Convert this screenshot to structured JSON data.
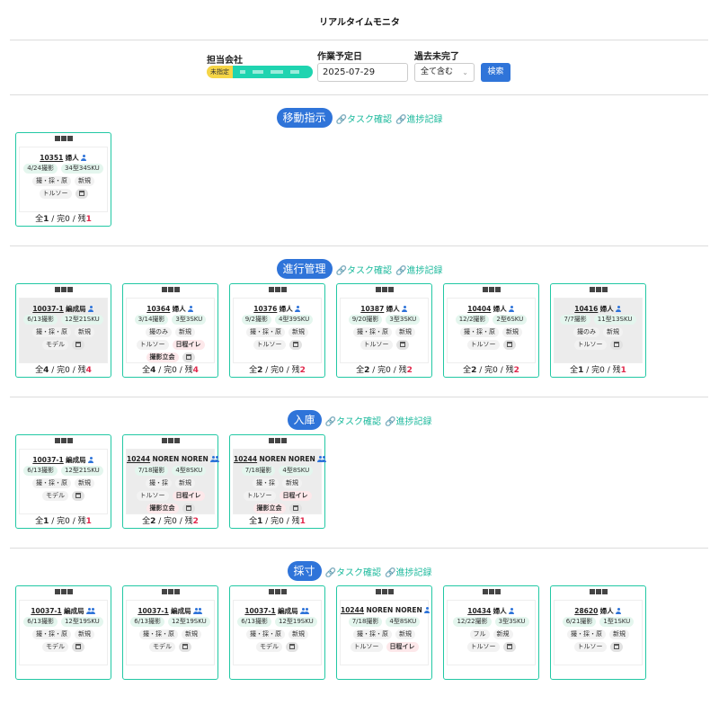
{
  "page": {
    "title": "リアルタイムモニタ"
  },
  "filter": {
    "company_label": "担当会社",
    "company_badge": "未指定",
    "date_label": "作業予定日",
    "date_value": "2025-07-29",
    "incomplete_label": "過去未完了",
    "incomplete_value": "全て含む",
    "search_label": "検索"
  },
  "sections": [
    {
      "title": "移動指示",
      "link1": "タスク確認",
      "link2": "進捗記録",
      "cards": [
        {
          "id": "10351",
          "name": "婦人",
          "icon": "person",
          "grey": false,
          "rows": [
            [
              "4/24撮影:green",
              "34型34SKU:green"
            ],
            [
              "撮・採・原",
              "新規"
            ],
            [
              "トルソー",
              "@cal"
            ]
          ],
          "total": "1",
          "done": "0",
          "rem": "1"
        }
      ]
    },
    {
      "title": "進行管理",
      "link1": "タスク確認",
      "link2": "進捗記録",
      "cards": [
        {
          "id": "10037-1",
          "name": "編成局",
          "icon": "person",
          "grey": true,
          "rows": [
            [
              "6/13撮影:green",
              "12型21SKU:green"
            ],
            [
              "撮・採・原",
              "新規"
            ],
            [
              "モデル",
              "@cal"
            ]
          ],
          "total": "4",
          "done": "0",
          "rem": "4"
        },
        {
          "id": "10364",
          "name": "婦人",
          "icon": "person",
          "grey": false,
          "rows": [
            [
              "3/14撮影:green",
              "3型3SKU:green"
            ],
            [
              "撮のみ",
              "新規"
            ],
            [
              "トルソー",
              "日程イレ:pink"
            ],
            [
              "撮影立会:pink",
              "@cal"
            ]
          ],
          "total": "4",
          "done": "0",
          "rem": "4"
        },
        {
          "id": "10376",
          "name": "婦人",
          "icon": "person",
          "grey": false,
          "rows": [
            [
              "9/2撮影:green",
              "4型39SKU:green"
            ],
            [
              "撮・採・原",
              "新規"
            ],
            [
              "トルソー",
              "@cal"
            ]
          ],
          "total": "2",
          "done": "0",
          "rem": "2"
        },
        {
          "id": "10387",
          "name": "婦人",
          "icon": "person",
          "grey": false,
          "rows": [
            [
              "9/20撮影:green",
              "3型3SKU:green"
            ],
            [
              "撮・採・原",
              "新規"
            ],
            [
              "トルソー",
              "@cal"
            ]
          ],
          "total": "2",
          "done": "0",
          "rem": "2"
        },
        {
          "id": "10404",
          "name": "婦人",
          "icon": "person",
          "grey": false,
          "rows": [
            [
              "12/2撮影:green",
              "2型6SKU:green"
            ],
            [
              "撮・採・原",
              "新規"
            ],
            [
              "トルソー",
              "@cal"
            ]
          ],
          "total": "2",
          "done": "0",
          "rem": "2"
        },
        {
          "id": "10416",
          "name": "婦人",
          "icon": "person",
          "grey": true,
          "rows": [
            [
              "7/7撮影:green",
              "11型13SKU:green"
            ],
            [
              "撮のみ",
              "新規"
            ],
            [
              "トルソー",
              "@cal"
            ]
          ],
          "total": "1",
          "done": "0",
          "rem": "1"
        }
      ]
    },
    {
      "title": "入庫",
      "link1": "タスク確認",
      "link2": "進捗記録",
      "cards": [
        {
          "id": "10037-1",
          "name": "編成局",
          "icon": "person",
          "grey": false,
          "rows": [
            [
              "6/13撮影:green",
              "12型21SKU:green"
            ],
            [
              "撮・採・原",
              "新規"
            ],
            [
              "モデル",
              "@cal"
            ]
          ],
          "total": "1",
          "done": "0",
          "rem": "1"
        },
        {
          "id": "10244",
          "name": "NOREN NOREN",
          "icon": "people",
          "grey": true,
          "rows": [
            [
              "7/18撮影:green",
              "4型8SKU:green"
            ],
            [
              "撮・採",
              "新規"
            ],
            [
              "トルソー",
              "日程イレ:pink"
            ],
            [
              "撮影立会:pink",
              "@cal"
            ]
          ],
          "total": "2",
          "done": "0",
          "rem": "2"
        },
        {
          "id": "10244",
          "name": "NOREN NOREN",
          "icon": "people",
          "grey": true,
          "rows": [
            [
              "7/18撮影:green",
              "4型8SKU:green"
            ],
            [
              "撮・採",
              "新規"
            ],
            [
              "トルソー",
              "日程イレ:pink"
            ],
            [
              "撮影立会:pink",
              "@cal"
            ]
          ],
          "total": "1",
          "done": "0",
          "rem": "1"
        }
      ]
    },
    {
      "title": "採寸",
      "link1": "タスク確認",
      "link2": "進捗記録",
      "cards": [
        {
          "id": "10037-1",
          "name": "編成局",
          "icon": "people",
          "grey": false,
          "rows": [
            [
              "6/13撮影:green",
              "12型19SKU:green"
            ],
            [
              "撮・採・原",
              "新規"
            ],
            [
              "モデル",
              "@cal"
            ]
          ],
          "total": "",
          "done": "",
          "rem": ""
        },
        {
          "id": "10037-1",
          "name": "編成局",
          "icon": "people",
          "grey": false,
          "rows": [
            [
              "6/13撮影:green",
              "12型19SKU:green"
            ],
            [
              "撮・採・原",
              "新規"
            ],
            [
              "モデル",
              "@cal"
            ]
          ],
          "total": "",
          "done": "",
          "rem": ""
        },
        {
          "id": "10037-1",
          "name": "編成局",
          "icon": "people",
          "grey": false,
          "rows": [
            [
              "6/13撮影:green",
              "12型19SKU:green"
            ],
            [
              "撮・採・原",
              "新規"
            ],
            [
              "モデル",
              "@cal"
            ]
          ],
          "total": "",
          "done": "",
          "rem": ""
        },
        {
          "id": "10244",
          "name": "NOREN NOREN",
          "icon": "person",
          "grey": false,
          "rows": [
            [
              "7/18撮影:green",
              "4型8SKU:green"
            ],
            [
              "撮・採・原",
              "新規"
            ],
            [
              "トルソー",
              "日程イレ:pink"
            ]
          ],
          "total": "",
          "done": "",
          "rem": ""
        },
        {
          "id": "10434",
          "name": "婦人",
          "icon": "person",
          "grey": false,
          "rows": [
            [
              "12/22撮影:green",
              "3型3SKU:green"
            ],
            [
              "フル",
              "新規"
            ],
            [
              "トルソー",
              "@cal"
            ]
          ],
          "total": "",
          "done": "",
          "rem": ""
        },
        {
          "id": "28620",
          "name": "婦人",
          "icon": "person",
          "grey": false,
          "rows": [
            [
              "6/21撮影:green",
              "1型1SKU:green"
            ],
            [
              "撮・採・原",
              "新規"
            ],
            [
              "トルソー",
              "@cal"
            ]
          ],
          "total": "",
          "done": "",
          "rem": ""
        }
      ]
    }
  ],
  "footer_labels": {
    "all": "全",
    "done": "完",
    "rem": "残",
    "sep": " / "
  }
}
